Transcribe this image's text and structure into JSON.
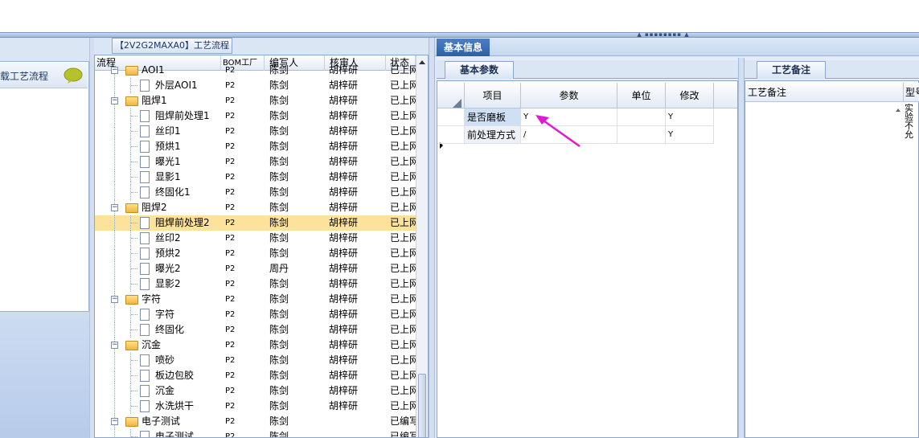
{
  "nav": {
    "item_label": "载工艺流程"
  },
  "tree": {
    "title": "【2V2G2MAXA0】工艺流程",
    "columns": {
      "flow": "流程",
      "bom": "BOM工厂",
      "author": "编写人",
      "reviewer": "核审人",
      "status": "状态"
    },
    "rows": [
      {
        "name": "AOI1",
        "bom": "P2",
        "author": "陈剑",
        "reviewer": "胡梓研",
        "status": "已上网"
      },
      {
        "name": "外层AOI1",
        "bom": "P2",
        "author": "陈剑",
        "reviewer": "胡梓研",
        "status": "已上网"
      },
      {
        "name": "阻焊1",
        "bom": "P2",
        "author": "陈剑",
        "reviewer": "胡梓研",
        "status": "已上网"
      },
      {
        "name": "阻焊前处理1",
        "bom": "P2",
        "author": "陈剑",
        "reviewer": "胡梓研",
        "status": "已上网"
      },
      {
        "name": "丝印1",
        "bom": "P2",
        "author": "陈剑",
        "reviewer": "胡梓研",
        "status": "已上网"
      },
      {
        "name": "预烘1",
        "bom": "P2",
        "author": "陈剑",
        "reviewer": "胡梓研",
        "status": "已上网"
      },
      {
        "name": "曝光1",
        "bom": "P2",
        "author": "陈剑",
        "reviewer": "胡梓研",
        "status": "已上网"
      },
      {
        "name": "显影1",
        "bom": "P2",
        "author": "陈剑",
        "reviewer": "胡梓研",
        "status": "已上网"
      },
      {
        "name": "终固化1",
        "bom": "P2",
        "author": "陈剑",
        "reviewer": "胡梓研",
        "status": "已上网"
      },
      {
        "name": "阻焊2",
        "bom": "P2",
        "author": "陈剑",
        "reviewer": "胡梓研",
        "status": "已上网"
      },
      {
        "name": "阻焊前处理2",
        "bom": "P2",
        "author": "陈剑",
        "reviewer": "胡梓研",
        "status": "已上网"
      },
      {
        "name": "丝印2",
        "bom": "P2",
        "author": "陈剑",
        "reviewer": "胡梓研",
        "status": "已上网"
      },
      {
        "name": "预烘2",
        "bom": "P2",
        "author": "陈剑",
        "reviewer": "胡梓研",
        "status": "已上网"
      },
      {
        "name": "曝光2",
        "bom": "P2",
        "author": "周丹",
        "reviewer": "胡梓研",
        "status": "已上网"
      },
      {
        "name": "显影2",
        "bom": "P2",
        "author": "陈剑",
        "reviewer": "胡梓研",
        "status": "已上网"
      },
      {
        "name": "字符",
        "bom": "P2",
        "author": "陈剑",
        "reviewer": "胡梓研",
        "status": "已上网"
      },
      {
        "name": "字符",
        "bom": "P2",
        "author": "陈剑",
        "reviewer": "胡梓研",
        "status": "已上网"
      },
      {
        "name": "终固化",
        "bom": "P2",
        "author": "陈剑",
        "reviewer": "胡梓研",
        "status": "已上网"
      },
      {
        "name": "沉金",
        "bom": "P2",
        "author": "陈剑",
        "reviewer": "胡梓研",
        "status": "已上网"
      },
      {
        "name": "喷砂",
        "bom": "P2",
        "author": "陈剑",
        "reviewer": "胡梓研",
        "status": "已上网"
      },
      {
        "name": "板边包胶",
        "bom": "P2",
        "author": "陈剑",
        "reviewer": "胡梓研",
        "status": "已上网"
      },
      {
        "name": "沉金",
        "bom": "P2",
        "author": "陈剑",
        "reviewer": "胡梓研",
        "status": "已上网"
      },
      {
        "name": "水洗烘干",
        "bom": "P2",
        "author": "陈剑",
        "reviewer": "胡梓研",
        "status": "已上网"
      },
      {
        "name": "电子测试",
        "bom": "P2",
        "author": "陈剑",
        "reviewer": "",
        "status": "已编写"
      },
      {
        "name": "电子测试",
        "bom": "P2",
        "author": "陈剑",
        "reviewer": "",
        "status": "已编写"
      }
    ]
  },
  "basic_info": {
    "tab": "基本信息",
    "params_tab": "基本参数",
    "headers": {
      "item": "项目",
      "param": "参数",
      "unit": "单位",
      "modify": "修改"
    },
    "rows": [
      {
        "item": "是否磨板",
        "param": "Y",
        "unit": "",
        "modify": "Y"
      },
      {
        "item": "前处理方式",
        "param": "/",
        "unit": "",
        "modify": "Y"
      }
    ]
  },
  "notes": {
    "tab": "工艺备注",
    "col1": "工艺备注",
    "col2": "型号",
    "text_line1": "实验",
    "text_line2": "不允"
  },
  "colors": {
    "selected_row": "#fce29b",
    "tab_active": "#2e5fa7",
    "cursor": "#e01ad0"
  }
}
